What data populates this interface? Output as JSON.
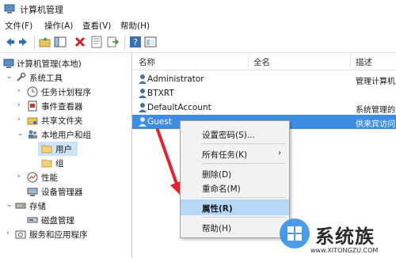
{
  "window": {
    "title": "计算机管理"
  },
  "menu": {
    "items": [
      "文件(F)",
      "操作(A)",
      "查看(V)",
      "帮助(H)"
    ]
  },
  "toolbar": {
    "icons": [
      "back-icon",
      "forward-icon",
      "up-folder-icon",
      "show-tree-icon",
      "delete-icon",
      "properties-icon",
      "export-icon",
      "help-icon",
      "console-icon"
    ]
  },
  "tree": {
    "root": "计算机管理(本地)",
    "system_tools": "系统工具",
    "task_scheduler": "任务计划程序",
    "event_viewer": "事件查看器",
    "shared_folders": "共享文件夹",
    "local_users_groups": "本地用户和组",
    "users": "用户",
    "groups": "组",
    "performance": "性能",
    "device_manager": "设备管理器",
    "storage": "存储",
    "disk_management": "磁盘管理",
    "services_apps": "服务和应用程序"
  },
  "list": {
    "columns": {
      "name": "名称",
      "fullname": "全名",
      "description": "描述"
    },
    "rows": [
      {
        "name": "Administrator",
        "description": "管理计算机"
      },
      {
        "name": "BTXRT",
        "description": ""
      },
      {
        "name": "DefaultAccount",
        "description": "系统管理的"
      },
      {
        "name": "Guest",
        "description": "供来宾访问"
      }
    ]
  },
  "context_menu": {
    "set_password": "设置密码(S)...",
    "all_tasks": "所有任务(K)",
    "all_tasks_arrow": "›",
    "delete": "删除(D)",
    "rename": "重命名(M)",
    "properties": "属性(R)",
    "help": "帮助(H)"
  },
  "watermark": {
    "brand": "系统族",
    "url": "www.XITONGZU.COM"
  },
  "colors": {
    "selection": "#3d8ee3",
    "menu_highlight": "#b6d7f5",
    "arrow": "#e8212a"
  }
}
